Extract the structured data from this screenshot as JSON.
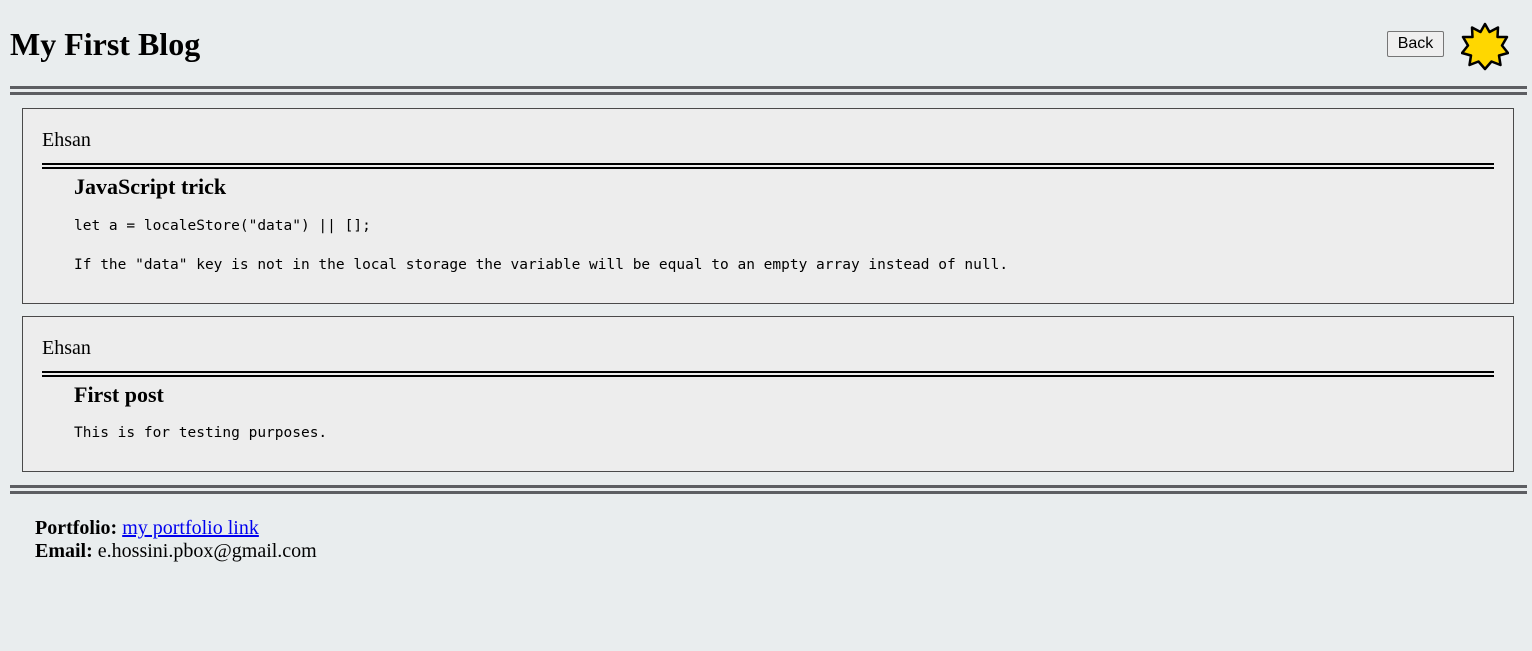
{
  "header": {
    "title": "My First Blog",
    "back_label": "Back",
    "theme_icon": "sun-icon",
    "theme_color": "#ffd700"
  },
  "posts": [
    {
      "author": "Ehsan",
      "title": "JavaScript trick",
      "lines": [
        "let a = localeStore(\"data\") || [];",
        "If the \"data\" key is not in the local storage the variable will be equal to an empty array instead of null."
      ]
    },
    {
      "author": "Ehsan",
      "title": "First post",
      "lines": [
        "This is for testing purposes."
      ]
    }
  ],
  "footer": {
    "portfolio_label": "Portfolio:",
    "portfolio_link": "my portfolio link",
    "email_label": "Email:",
    "email_value": "e.hossini.pbox@gmail.com"
  },
  "colors": {
    "background": "#e9edee",
    "post_background": "#ededed",
    "rule": "#5d5e62",
    "link": "#0000ee"
  }
}
